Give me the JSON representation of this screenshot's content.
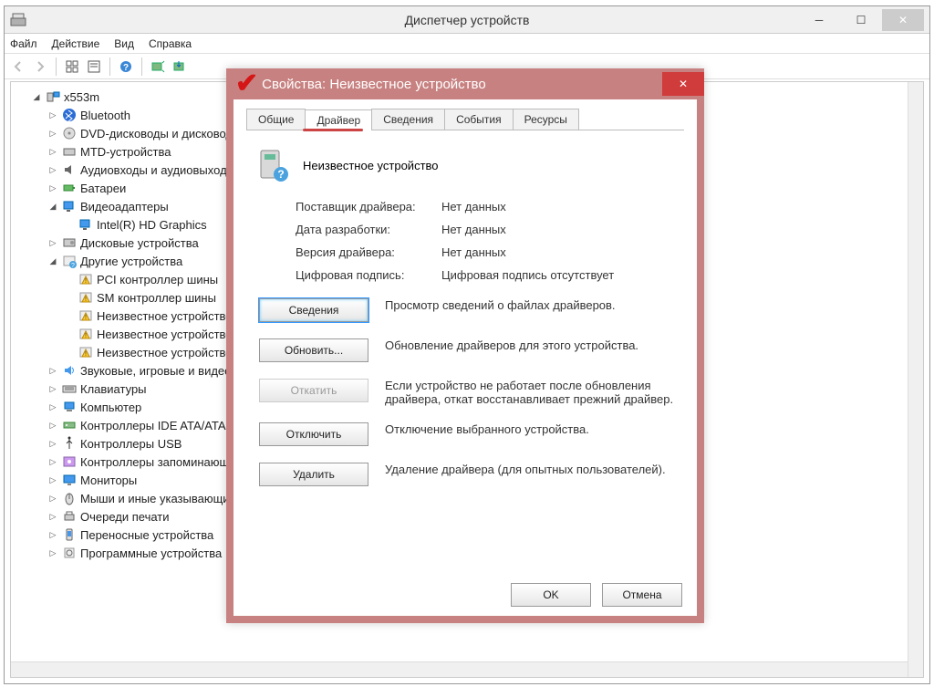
{
  "window": {
    "title": "Диспетчер устройств",
    "menu": {
      "file": "Файл",
      "action": "Действие",
      "view": "Вид",
      "help": "Справка"
    }
  },
  "tree": {
    "root": "x553m",
    "items": [
      {
        "label": "Bluetooth",
        "icon": "bluetooth"
      },
      {
        "label": "DVD-дисководы и дисководы компакт-дисков",
        "icon": "dvd"
      },
      {
        "label": "MTD-устройства",
        "icon": "mtd"
      },
      {
        "label": "Аудиовходы и аудиовыходы",
        "icon": "audio"
      },
      {
        "label": "Батареи",
        "icon": "battery"
      },
      {
        "label": "Видеоадаптеры",
        "icon": "video",
        "expanded": true,
        "children": [
          {
            "label": "Intel(R) HD Graphics",
            "icon": "video"
          }
        ]
      },
      {
        "label": "Дисковые устройства",
        "icon": "disk"
      },
      {
        "label": "Другие устройства",
        "icon": "other",
        "expanded": true,
        "children": [
          {
            "label": "PCI контроллер шины",
            "icon": "warn"
          },
          {
            "label": "SM контроллер шины",
            "icon": "warn"
          },
          {
            "label": "Неизвестное устройство",
            "icon": "warn"
          },
          {
            "label": "Неизвестное устройство",
            "icon": "warn"
          },
          {
            "label": "Неизвестное устройство",
            "icon": "warn"
          }
        ]
      },
      {
        "label": "Звуковые, игровые и видеоустройства",
        "icon": "sound"
      },
      {
        "label": "Клавиатуры",
        "icon": "keyboard"
      },
      {
        "label": "Компьютер",
        "icon": "computer"
      },
      {
        "label": "Контроллеры IDE ATA/ATAPI",
        "icon": "ide"
      },
      {
        "label": "Контроллеры USB",
        "icon": "usb"
      },
      {
        "label": "Контроллеры запоминающих устройств",
        "icon": "storage"
      },
      {
        "label": "Мониторы",
        "icon": "monitor"
      },
      {
        "label": "Мыши и иные указывающие устройства",
        "icon": "mouse"
      },
      {
        "label": "Очереди печати",
        "icon": "print"
      },
      {
        "label": "Переносные устройства",
        "icon": "portable"
      },
      {
        "label": "Программные устройства",
        "icon": "software"
      }
    ]
  },
  "dialog": {
    "title": "Свойства: Неизвестное устройство",
    "tabs": {
      "general": "Общие",
      "driver": "Драйвер",
      "details": "Сведения",
      "events": "События",
      "resources": "Ресурсы"
    },
    "device_name": "Неизвестное устройство",
    "info": {
      "provider_lbl": "Поставщик драйвера:",
      "provider_val": "Нет данных",
      "date_lbl": "Дата разработки:",
      "date_val": "Нет данных",
      "version_lbl": "Версия драйвера:",
      "version_val": "Нет данных",
      "signer_lbl": "Цифровая подпись:",
      "signer_val": "Цифровая подпись отсутствует"
    },
    "buttons": {
      "details": "Сведения",
      "details_desc": "Просмотр сведений о файлах драйверов.",
      "update": "Обновить...",
      "update_desc": "Обновление драйверов для этого устройства.",
      "rollback": "Откатить",
      "rollback_desc": "Если устройство не работает после обновления драйвера, откат восстанавливает прежний драйвер.",
      "disable": "Отключить",
      "disable_desc": "Отключение выбранного устройства.",
      "uninstall": "Удалить",
      "uninstall_desc": "Удаление драйвера (для опытных пользователей)."
    },
    "footer": {
      "ok": "OK",
      "cancel": "Отмена"
    }
  }
}
